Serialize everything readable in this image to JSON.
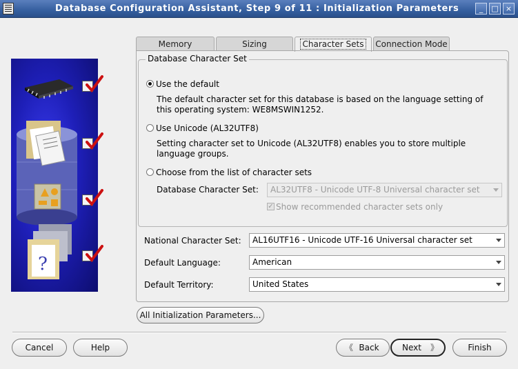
{
  "window": {
    "title": "Database Configuration Assistant, Step 9 of 11 : Initialization Parameters",
    "min_glyph": "_",
    "max_glyph": "□",
    "close_glyph": "×"
  },
  "tabs": [
    {
      "label": "Memory",
      "selected": false
    },
    {
      "label": "Sizing",
      "selected": false
    },
    {
      "label": "Character Sets",
      "selected": true
    },
    {
      "label": "Connection Mode",
      "selected": false
    }
  ],
  "charset": {
    "group_title": "Database Character Set",
    "option_default": {
      "label": "Use the default",
      "checked": true,
      "description": "The default character set for this database is based on the language setting of this operating system: WE8MSWIN1252."
    },
    "option_unicode": {
      "label": "Use Unicode (AL32UTF8)",
      "checked": false,
      "description": "Setting character set to Unicode (AL32UTF8) enables you to store multiple language groups."
    },
    "option_choose": {
      "label": "Choose from the list of character sets",
      "checked": false
    },
    "db_charset_label": "Database Character Set:",
    "db_charset_value": "AL32UTF8 - Unicode UTF-8 Universal character set",
    "show_recommended_label": "Show recommended character sets only",
    "show_recommended_checked": true
  },
  "national": {
    "label": "National Character Set:",
    "value": "AL16UTF16 - Unicode UTF-16 Universal character set"
  },
  "language": {
    "label": "Default Language:",
    "value": "American"
  },
  "territory": {
    "label": "Default Territory:",
    "value": "United States"
  },
  "buttons": {
    "all_params": "All Initialization Parameters...",
    "cancel": "Cancel",
    "help": "Help",
    "back": "Back",
    "next": "Next",
    "finish": "Finish"
  },
  "colors": {
    "titlebar": "#355f9f",
    "side_panel": "#1e1fb8",
    "check_red": "#cc1111"
  }
}
